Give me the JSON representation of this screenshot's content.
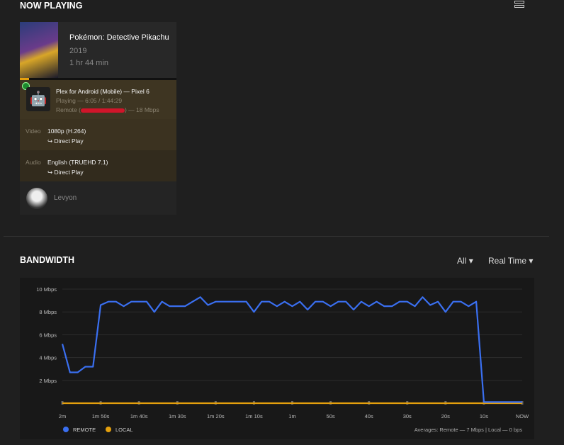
{
  "now_playing": {
    "title": "NOW PLAYING",
    "movie": "Pokémon: Detective Pikachu",
    "year": "2019",
    "duration": "1 hr 44 min",
    "progress_fraction": 0.058,
    "player": "Plex for Android (Mobile)  —  Pixel 6",
    "state": "Playing — 6:05 / 1:44:29",
    "remote_prefix": "Remote (",
    "remote_suffix": ") — 18 Mbps",
    "video_label": "Video",
    "video_value": "1080p (H.264)",
    "video_mode": "↪  Direct Play",
    "audio_label": "Audio",
    "audio_value": "English (TRUEHD 7.1)",
    "audio_mode": "↪  Direct Play",
    "user": "Levyon"
  },
  "bandwidth": {
    "title": "BANDWIDTH",
    "filter": "All",
    "range": "Real Time",
    "averages": "Averages: Remote — 7 Mbps | Local — 0 bps"
  },
  "colors": {
    "remote": "#3a6ff0",
    "local": "#e5a00d"
  },
  "chart_data": {
    "type": "line",
    "ylabel": "",
    "ylim": [
      0,
      10
    ],
    "yticks": [
      "2 Mbps",
      "4 Mbps",
      "6 Mbps",
      "8 Mbps",
      "10 Mbps"
    ],
    "xticks": [
      "2m",
      "1m 50s",
      "1m 40s",
      "1m 30s",
      "1m 20s",
      "1m 10s",
      "1m",
      "50s",
      "40s",
      "30s",
      "20s",
      "10s",
      "NOW"
    ],
    "x_seconds_ago": [
      120,
      118,
      116,
      114,
      112,
      110,
      108,
      106,
      104,
      102,
      100,
      98,
      96,
      94,
      92,
      90,
      88,
      86,
      84,
      82,
      80,
      78,
      76,
      74,
      72,
      70,
      68,
      66,
      64,
      62,
      60,
      58,
      56,
      54,
      52,
      50,
      48,
      46,
      44,
      42,
      40,
      38,
      36,
      34,
      32,
      30,
      28,
      26,
      24,
      22,
      20,
      18,
      16,
      14,
      12,
      10,
      8,
      6,
      4,
      2,
      0
    ],
    "series": [
      {
        "name": "REMOTE",
        "values": [
          5.2,
          2.7,
          2.7,
          3.2,
          3.2,
          8.6,
          8.9,
          8.9,
          8.5,
          8.9,
          8.9,
          8.9,
          8.0,
          8.9,
          8.5,
          8.5,
          8.5,
          8.9,
          9.3,
          8.6,
          8.9,
          8.9,
          8.9,
          8.9,
          8.9,
          8.0,
          8.9,
          8.9,
          8.5,
          8.9,
          8.5,
          8.9,
          8.2,
          8.9,
          8.9,
          8.5,
          8.9,
          8.9,
          8.2,
          8.9,
          8.5,
          8.9,
          8.5,
          8.5,
          8.9,
          8.9,
          8.5,
          9.3,
          8.6,
          8.9,
          8.0,
          8.9,
          8.9,
          8.5,
          8.9,
          0.1,
          0.1,
          0.1,
          0.1,
          0.1,
          0.1
        ]
      },
      {
        "name": "LOCAL",
        "values": [
          0,
          0,
          0,
          0,
          0,
          0,
          0,
          0,
          0,
          0,
          0,
          0,
          0,
          0,
          0,
          0,
          0,
          0,
          0,
          0,
          0,
          0,
          0,
          0,
          0,
          0,
          0,
          0,
          0,
          0,
          0,
          0,
          0,
          0,
          0,
          0,
          0,
          0,
          0,
          0,
          0,
          0,
          0,
          0,
          0,
          0,
          0,
          0,
          0,
          0,
          0,
          0,
          0,
          0,
          0,
          0,
          0,
          0,
          0,
          0,
          0
        ]
      }
    ]
  }
}
